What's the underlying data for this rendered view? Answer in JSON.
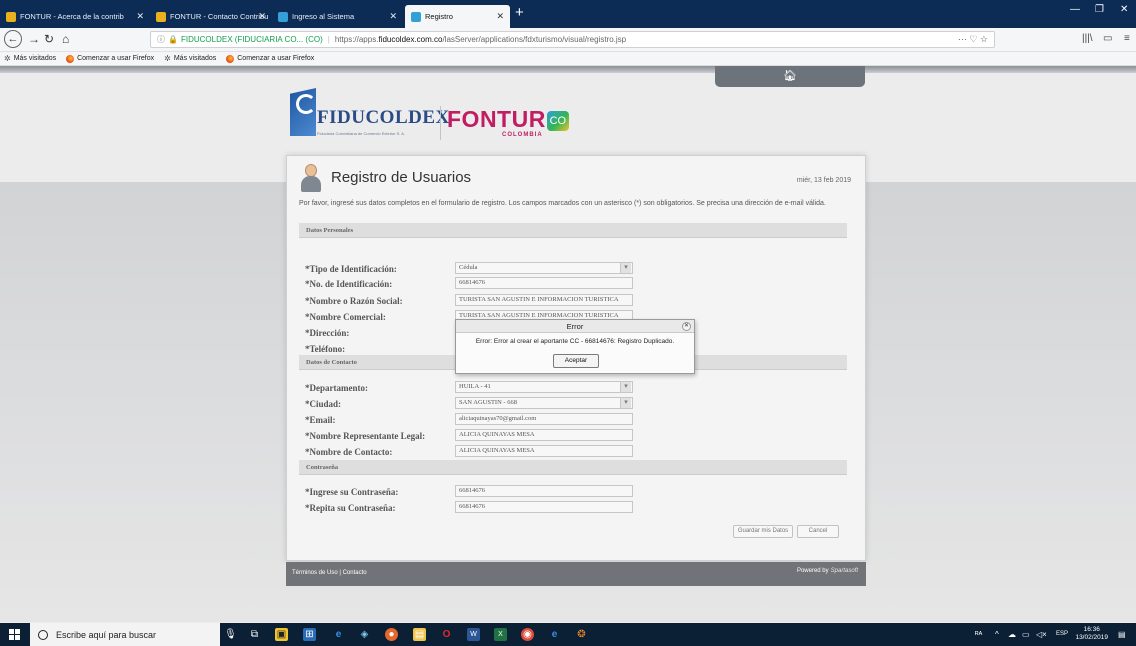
{
  "browser": {
    "tabs": [
      {
        "title": "FONTUR - Acerca de la contrib",
        "favicon_color": "#e9b21c"
      },
      {
        "title": "FONTUR - Contacto Contribu",
        "favicon_color": "#e9b21c"
      },
      {
        "title": "Ingreso al Sistema",
        "favicon_color": "#33a0d8"
      },
      {
        "title": "Registro",
        "favicon_color": "#33a0d8"
      }
    ],
    "url": {
      "site_identity": "FIDUCOLDEX (FIDUCIARIA CO... (CO)",
      "prefix": "https://apps.",
      "host": "fiducoldex.com.co",
      "path": "/lasServer/applications/fdxturismo/visual/registro.jsp",
      "page_actions": "··· ♡ ☆"
    },
    "bookmarks": [
      {
        "label": "Más visitados",
        "icon": "gear-icon"
      },
      {
        "label": "Comenzar a usar Firefox",
        "icon": "firefox-icon"
      },
      {
        "label": "Más visitados",
        "icon": "gear-icon"
      },
      {
        "label": "Comenzar a usar Firefox",
        "icon": "firefox-icon"
      }
    ]
  },
  "logos": {
    "fiducoldex": {
      "word": "FIDUCOLDEX",
      "sub": "Fiduciaria Colombiana de Comercio Exterior S. A."
    },
    "fontur": {
      "word": "FONTUR",
      "badge": "CO",
      "sub": "COLOMBIA"
    }
  },
  "form": {
    "title": "Registro de Usuarios",
    "date": "miér, 13 feb 2019",
    "intro": "Por favor, ingresé sus datos completos en el formulario de registro. Los campos marcados con un asterisco (*) son obligatorios. Se precisa una dirección de e-mail válida.",
    "sections": {
      "personal": "Datos Personales",
      "contact": "Datos de Contacto",
      "password": "Contraseña"
    },
    "fields": {
      "tipo_id": {
        "label": "*Tipo de Identificación:",
        "value": "Cédula"
      },
      "num_id": {
        "label": "*No. de Identificación:",
        "value": "66814676"
      },
      "nombre": {
        "label": "*Nombre o Razón Social:",
        "value": "TURISTA SAN AGUSTIN E INFORMACION TURISTICA"
      },
      "comercial": {
        "label": "*Nombre Comercial:",
        "value": "TURISTA SAN AGUSTIN E INFORMACION TURISTICA"
      },
      "direccion": {
        "label": "*Dirección:",
        "value": ""
      },
      "telefono": {
        "label": "*Teléfono:",
        "value": ""
      },
      "departamento": {
        "label": "*Departamento:",
        "value": "HUILA - 41"
      },
      "ciudad": {
        "label": "*Ciudad:",
        "value": "SAN AGUSTIN - 668"
      },
      "email": {
        "label": "*Email:",
        "value": "aliciaquinayas70@gmail.com"
      },
      "representante": {
        "label": "*Nombre Representante Legal:",
        "value": "ALICIA QUINAYAS MESA"
      },
      "contacto": {
        "label": "*Nombre de Contacto:",
        "value": "ALICIA QUINAYAS MESA"
      },
      "pass1": {
        "label": "*Ingrese su Contraseña:",
        "value": "66814676"
      },
      "pass2": {
        "label": "*Repita su Contraseña:",
        "value": "66814676"
      }
    },
    "buttons": {
      "save": "Guardar mis Datos",
      "cancel": "Cancel"
    },
    "footer": {
      "links": "Términos de Uso | Contacto",
      "powered": "Powered by",
      "brand": "Spartasoft"
    }
  },
  "dialog": {
    "title": "Error",
    "message": "Error: Error al crear el aportante CC - 66814676: Registro Duplicado.",
    "ok": "Aceptar"
  },
  "taskbar": {
    "search_placeholder": "Escribe aquí para buscar",
    "lang": "ESP",
    "time": "16:36",
    "date": "13/02/2019"
  }
}
